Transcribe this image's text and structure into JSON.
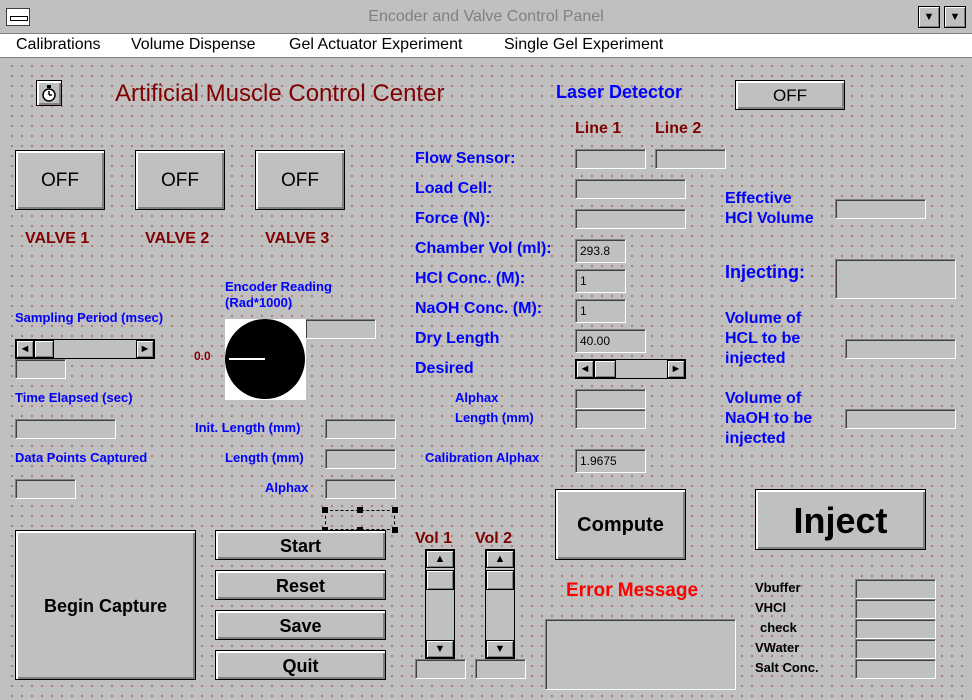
{
  "window": {
    "title": "Encoder and Valve Control Panel"
  },
  "menu": [
    "Calibrations",
    "Volume Dispense",
    "Gel Actuator Experiment",
    "Single Gel Experiment"
  ],
  "header": {
    "title": "Artificial Muscle Control Center"
  },
  "laser": {
    "label": "Laser Detector",
    "state": "OFF"
  },
  "valves": [
    {
      "state": "OFF",
      "label": "VALVE 1"
    },
    {
      "state": "OFF",
      "label": "VALVE 2"
    },
    {
      "state": "OFF",
      "label": "VALVE 3"
    }
  ],
  "lines": {
    "line1": "Line 1",
    "line2": "Line 2"
  },
  "sensors": {
    "flow": {
      "label": "Flow Sensor:"
    },
    "load": {
      "label": "Load Cell:"
    },
    "force": {
      "label": "Force (N):"
    },
    "chamber": {
      "label": "Chamber Vol (ml):",
      "value": "293.8"
    },
    "hcl": {
      "label": "HCl Conc. (M):",
      "value": "1"
    },
    "naoh": {
      "label": "NaOH Conc. (M):",
      "value": "1"
    },
    "dry": {
      "label": "Dry Length",
      "value": "40.00"
    },
    "desired": {
      "label": "Desired"
    },
    "alphax_length": {
      "label1": "Alphax",
      "label2": "Length (mm)"
    },
    "calibration": {
      "label": "Calibration Alphax",
      "value": "1.9675"
    }
  },
  "left": {
    "encoder_label1": "Encoder Reading",
    "encoder_label2": "(Rad*1000)",
    "encoder_zero": "0.0",
    "sampling": "Sampling Period (msec)",
    "time_elapsed": "Time Elapsed (sec)",
    "data_points": "Data Points Captured",
    "init_length": "Init. Length (mm)",
    "length": "Length (mm)",
    "alphax": "Alphax"
  },
  "right": {
    "effective1": "Effective",
    "effective2": "HCl Volume",
    "injecting": "Injecting:",
    "vol_hcl": [
      "Volume of",
      "HCL to be",
      "injected"
    ],
    "vol_naoh": [
      "Volume of",
      "NaOH to be",
      "injected"
    ]
  },
  "buttons": {
    "begin_capture": "Begin Capture",
    "start": "Start",
    "reset": "Reset",
    "save": "Save",
    "quit": "Quit",
    "compute": "Compute",
    "inject": "Inject"
  },
  "vols": {
    "vol1": "Vol 1",
    "vol2": "Vol 2"
  },
  "error": {
    "label": "Error Message"
  },
  "bottom_right": [
    "Vbuffer",
    "VHCl",
    "check",
    "VWater",
    "Salt Conc."
  ],
  "icons": {
    "system_menu": "system-menu-icon",
    "minimize": "▼",
    "maximize": "▲",
    "clock": "stopwatch-icon",
    "left_arrow": "◄",
    "right_arrow": "►",
    "up_arrow": "▲",
    "down_arrow": "▼"
  },
  "colors": {
    "blue": "#0000ff",
    "dark_red": "#800000",
    "error_red": "#ff0000",
    "dots": "#b26a6a"
  }
}
